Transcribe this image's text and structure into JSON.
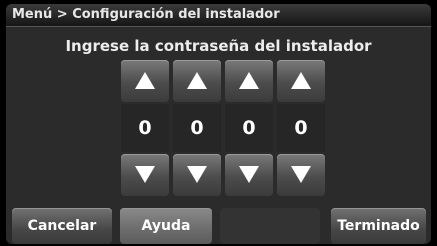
{
  "breadcrumb": "Menú > Configuración del instalador",
  "prompt": "Ingrese la contraseña del instalador",
  "digits": [
    "0",
    "0",
    "0",
    "0"
  ],
  "buttons": {
    "cancel": "Cancelar",
    "help": "Ayuda",
    "done": "Terminado"
  },
  "icons": {
    "up": "up-arrow-icon",
    "down": "down-arrow-icon"
  }
}
